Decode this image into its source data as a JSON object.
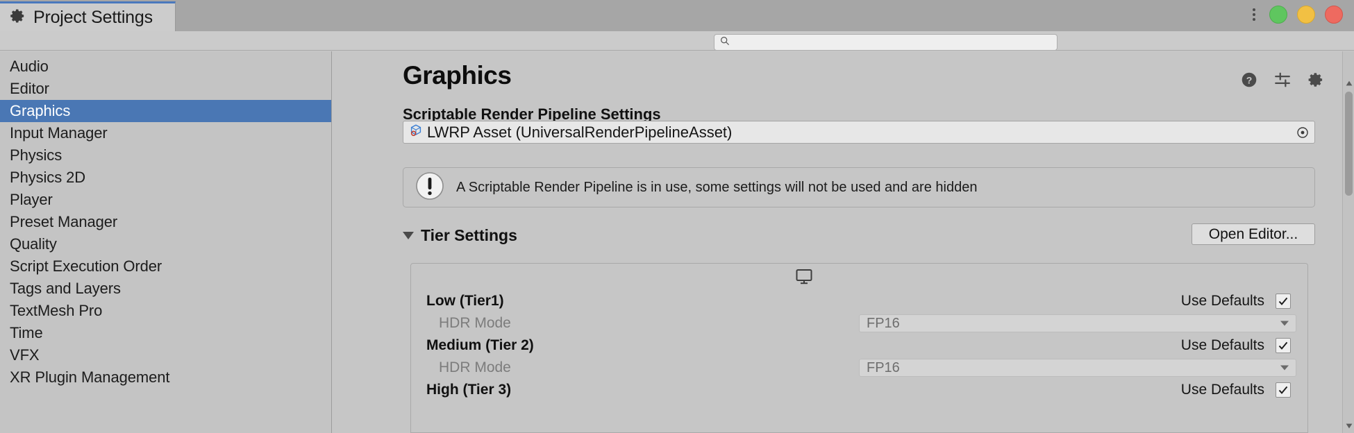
{
  "window": {
    "tab_title": "Project Settings",
    "tab_icon": "gear-icon",
    "controls": {
      "menu_icon": "kebab-menu-icon",
      "maximize": "green",
      "minimize": "yellow",
      "close": "red"
    },
    "accent_tab_color": "#4a78bd"
  },
  "search": {
    "placeholder": "",
    "value": "",
    "icon": "search-icon"
  },
  "sidebar": {
    "selected": "Graphics",
    "selected_color": "#4a77b4",
    "items": [
      {
        "label": "Audio"
      },
      {
        "label": "Editor"
      },
      {
        "label": "Graphics"
      },
      {
        "label": "Input Manager"
      },
      {
        "label": "Physics"
      },
      {
        "label": "Physics 2D"
      },
      {
        "label": "Player"
      },
      {
        "label": "Preset Manager"
      },
      {
        "label": "Quality"
      },
      {
        "label": "Script Execution Order"
      },
      {
        "label": "Tags and Layers"
      },
      {
        "label": "TextMesh Pro"
      },
      {
        "label": "Time"
      },
      {
        "label": "VFX"
      },
      {
        "label": "XR Plugin Management"
      }
    ]
  },
  "main": {
    "title": "Graphics",
    "header_icons": [
      {
        "name": "help-icon"
      },
      {
        "name": "preset-sliders-icon"
      },
      {
        "name": "settings-gear-icon"
      }
    ],
    "srp": {
      "section_label": "Scriptable Render Pipeline Settings",
      "asset_value": "LWRP Asset (UniversalRenderPipelineAsset)",
      "asset_icon": "scriptable-object-asset-icon",
      "picker_icon": "object-picker-icon"
    },
    "warning": {
      "icon": "warning-exclamation-icon",
      "text": "A Scriptable Render Pipeline is in use, some settings will not be used and are hidden"
    },
    "tier_settings": {
      "foldout_label": "Tier Settings",
      "foldout_expanded": true,
      "open_editor_label": "Open Editor...",
      "platform_icon": "desktop-monitor-icon",
      "use_defaults_label": "Use Defaults",
      "tiers": [
        {
          "name": "Low (Tier1)",
          "use_defaults": true,
          "properties": [
            {
              "label": "HDR Mode",
              "value": "FP16"
            }
          ]
        },
        {
          "name": "Medium (Tier 2)",
          "use_defaults": true,
          "properties": [
            {
              "label": "HDR Mode",
              "value": "FP16"
            }
          ]
        },
        {
          "name": "High (Tier 3)",
          "use_defaults": true,
          "properties": []
        }
      ]
    }
  }
}
